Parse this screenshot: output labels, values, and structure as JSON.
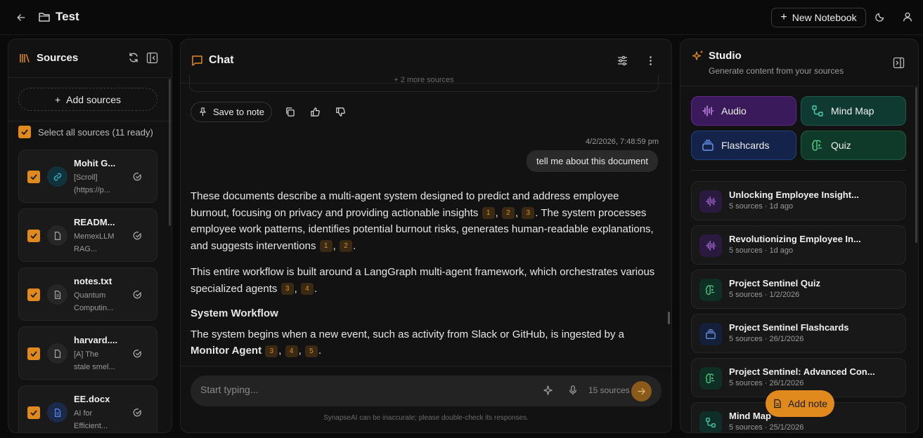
{
  "header": {
    "notebook_title": "Test",
    "new_notebook_label": "New Notebook"
  },
  "sources": {
    "title": "Sources",
    "add_label": "Add sources",
    "select_all_label": "Select all sources (11 ready)",
    "items": [
      {
        "name": "Mohit G...",
        "desc1": "[Scroll]",
        "desc2": "(https://p...",
        "icon": "link-icon"
      },
      {
        "name": "READM...",
        "desc1": "MemexLLM",
        "desc2": "RAG...",
        "icon": "file-icon"
      },
      {
        "name": "notes.txt",
        "desc1": "Quantum",
        "desc2": "Computin...",
        "icon": "file-text-icon"
      },
      {
        "name": "harvard....",
        "desc1": "[A] The",
        "desc2": "stale smel...",
        "icon": "file-icon"
      },
      {
        "name": "EE.docx",
        "desc1": "AI for",
        "desc2": "Efficient...",
        "icon": "doc-icon"
      }
    ]
  },
  "chat": {
    "title": "Chat",
    "more_sources_label": "+ 2 more sources",
    "save_note_label": "Save to note",
    "timestamp": "4/2/2026, 7:48:59 pm",
    "user_message": "tell me about this document",
    "answer": {
      "p1_a": "These documents describe a multi-agent system designed to predict and address employee burnout, focusing on privacy and providing actionable insights",
      "p1_b": ". The system processes employee work patterns, identifies potential burnout risks, generates human-readable explanations, and suggests interventions",
      "p2": "This entire workflow is built around a LangGraph multi-agent framework, which orchestrates various specialized agents",
      "h3": "System Workflow",
      "p3_a": "The system begins when a new event, such as activity from Slack or GitHub, is ingested by a",
      "p3_bold": "Monitor Agent"
    },
    "citations": {
      "c1": "1",
      "c2": "2",
      "c3": "3",
      "c4": "4",
      "c5": "5"
    },
    "composer_placeholder": "Start typing...",
    "sources_count": "15 sources",
    "disclaimer": "SynapseAI can be inaccurate; please double-check its responses."
  },
  "studio": {
    "title": "Studio",
    "subtitle": "Generate content from your sources",
    "tools": {
      "audio": "Audio",
      "mind_map": "Mind Map",
      "flashcards": "Flashcards",
      "quiz": "Quiz"
    },
    "notes": [
      {
        "title": "Unlocking Employee Insight...",
        "meta": "5 sources · 1d ago",
        "type": "audio"
      },
      {
        "title": "Revolutionizing Employee In...",
        "meta": "5 sources · 1d ago",
        "type": "audio"
      },
      {
        "title": "Project Sentinel Quiz",
        "meta": "5 sources · 1/2/2026",
        "type": "quiz"
      },
      {
        "title": "Project Sentinel Flashcards",
        "meta": "5 sources · 26/1/2026",
        "type": "flash"
      },
      {
        "title": "Project Sentinel: Advanced Con...",
        "meta": "5 sources · 26/1/2026",
        "type": "quiz"
      },
      {
        "title": "Mind Map",
        "meta": "5 sources · 25/1/2026",
        "type": "mind"
      }
    ],
    "add_note_label": "Add note"
  },
  "colors": {
    "accent": "#e08a1e",
    "background": "#0a0a0a",
    "panel": "#121212"
  }
}
